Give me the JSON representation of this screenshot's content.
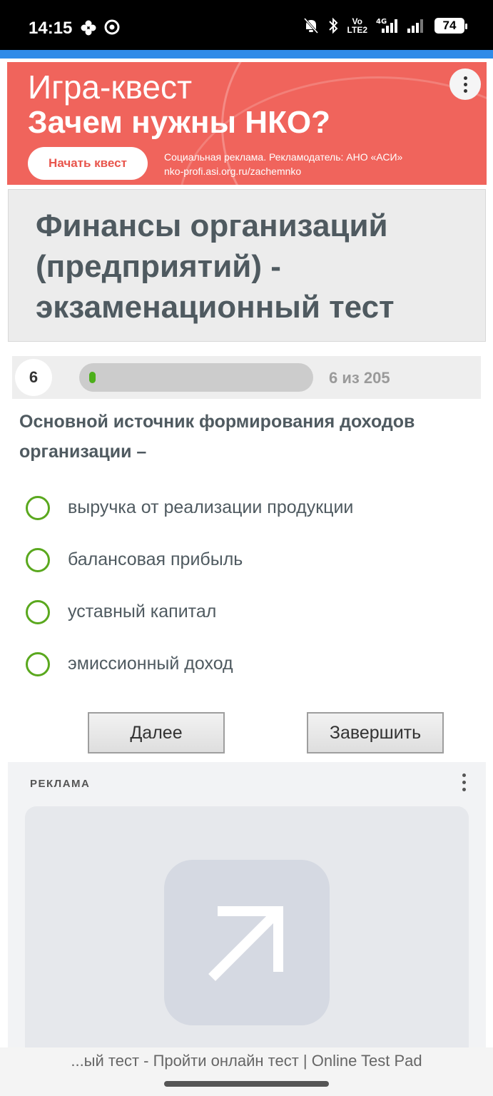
{
  "status_bar": {
    "time": "14:15",
    "network_volte": "Vo\nLTE2",
    "network_4g": "4G",
    "battery": "74",
    "icons": [
      "app-icon",
      "chrome-icon",
      "mute-icon",
      "bluetooth-icon",
      "signal-icon",
      "signal-icon"
    ]
  },
  "banner": {
    "title_line1": "Игра-квест",
    "title_line2": "Зачем нужны НКО?",
    "button_label": "Начать квест",
    "disclaimer": "Социальная реклама. Рекламодатель: АНО «АСИ»",
    "url": "nko-profi.asi.org.ru/zachemnko",
    "bg_color": "#f0645c"
  },
  "page": {
    "title": "Финансы организаций (предприятий) - экзаменационный тест"
  },
  "progress": {
    "current": "6",
    "text": "6 из 205",
    "fraction": 0.029,
    "fill_color": "#4caf1a"
  },
  "question": {
    "text": "Основной источник формирования доходов организации –",
    "answers": [
      "выручка от реализации продукции",
      "балансовая прибыль",
      "уставный капитал",
      "эмиссионный доход"
    ]
  },
  "buttons": {
    "next": "Далее",
    "finish": "Завершить"
  },
  "ad": {
    "label": "РЕКЛАМА"
  },
  "browser": {
    "tab_title": "...ый тест - Пройти онлайн тест | Online Test Pad"
  }
}
